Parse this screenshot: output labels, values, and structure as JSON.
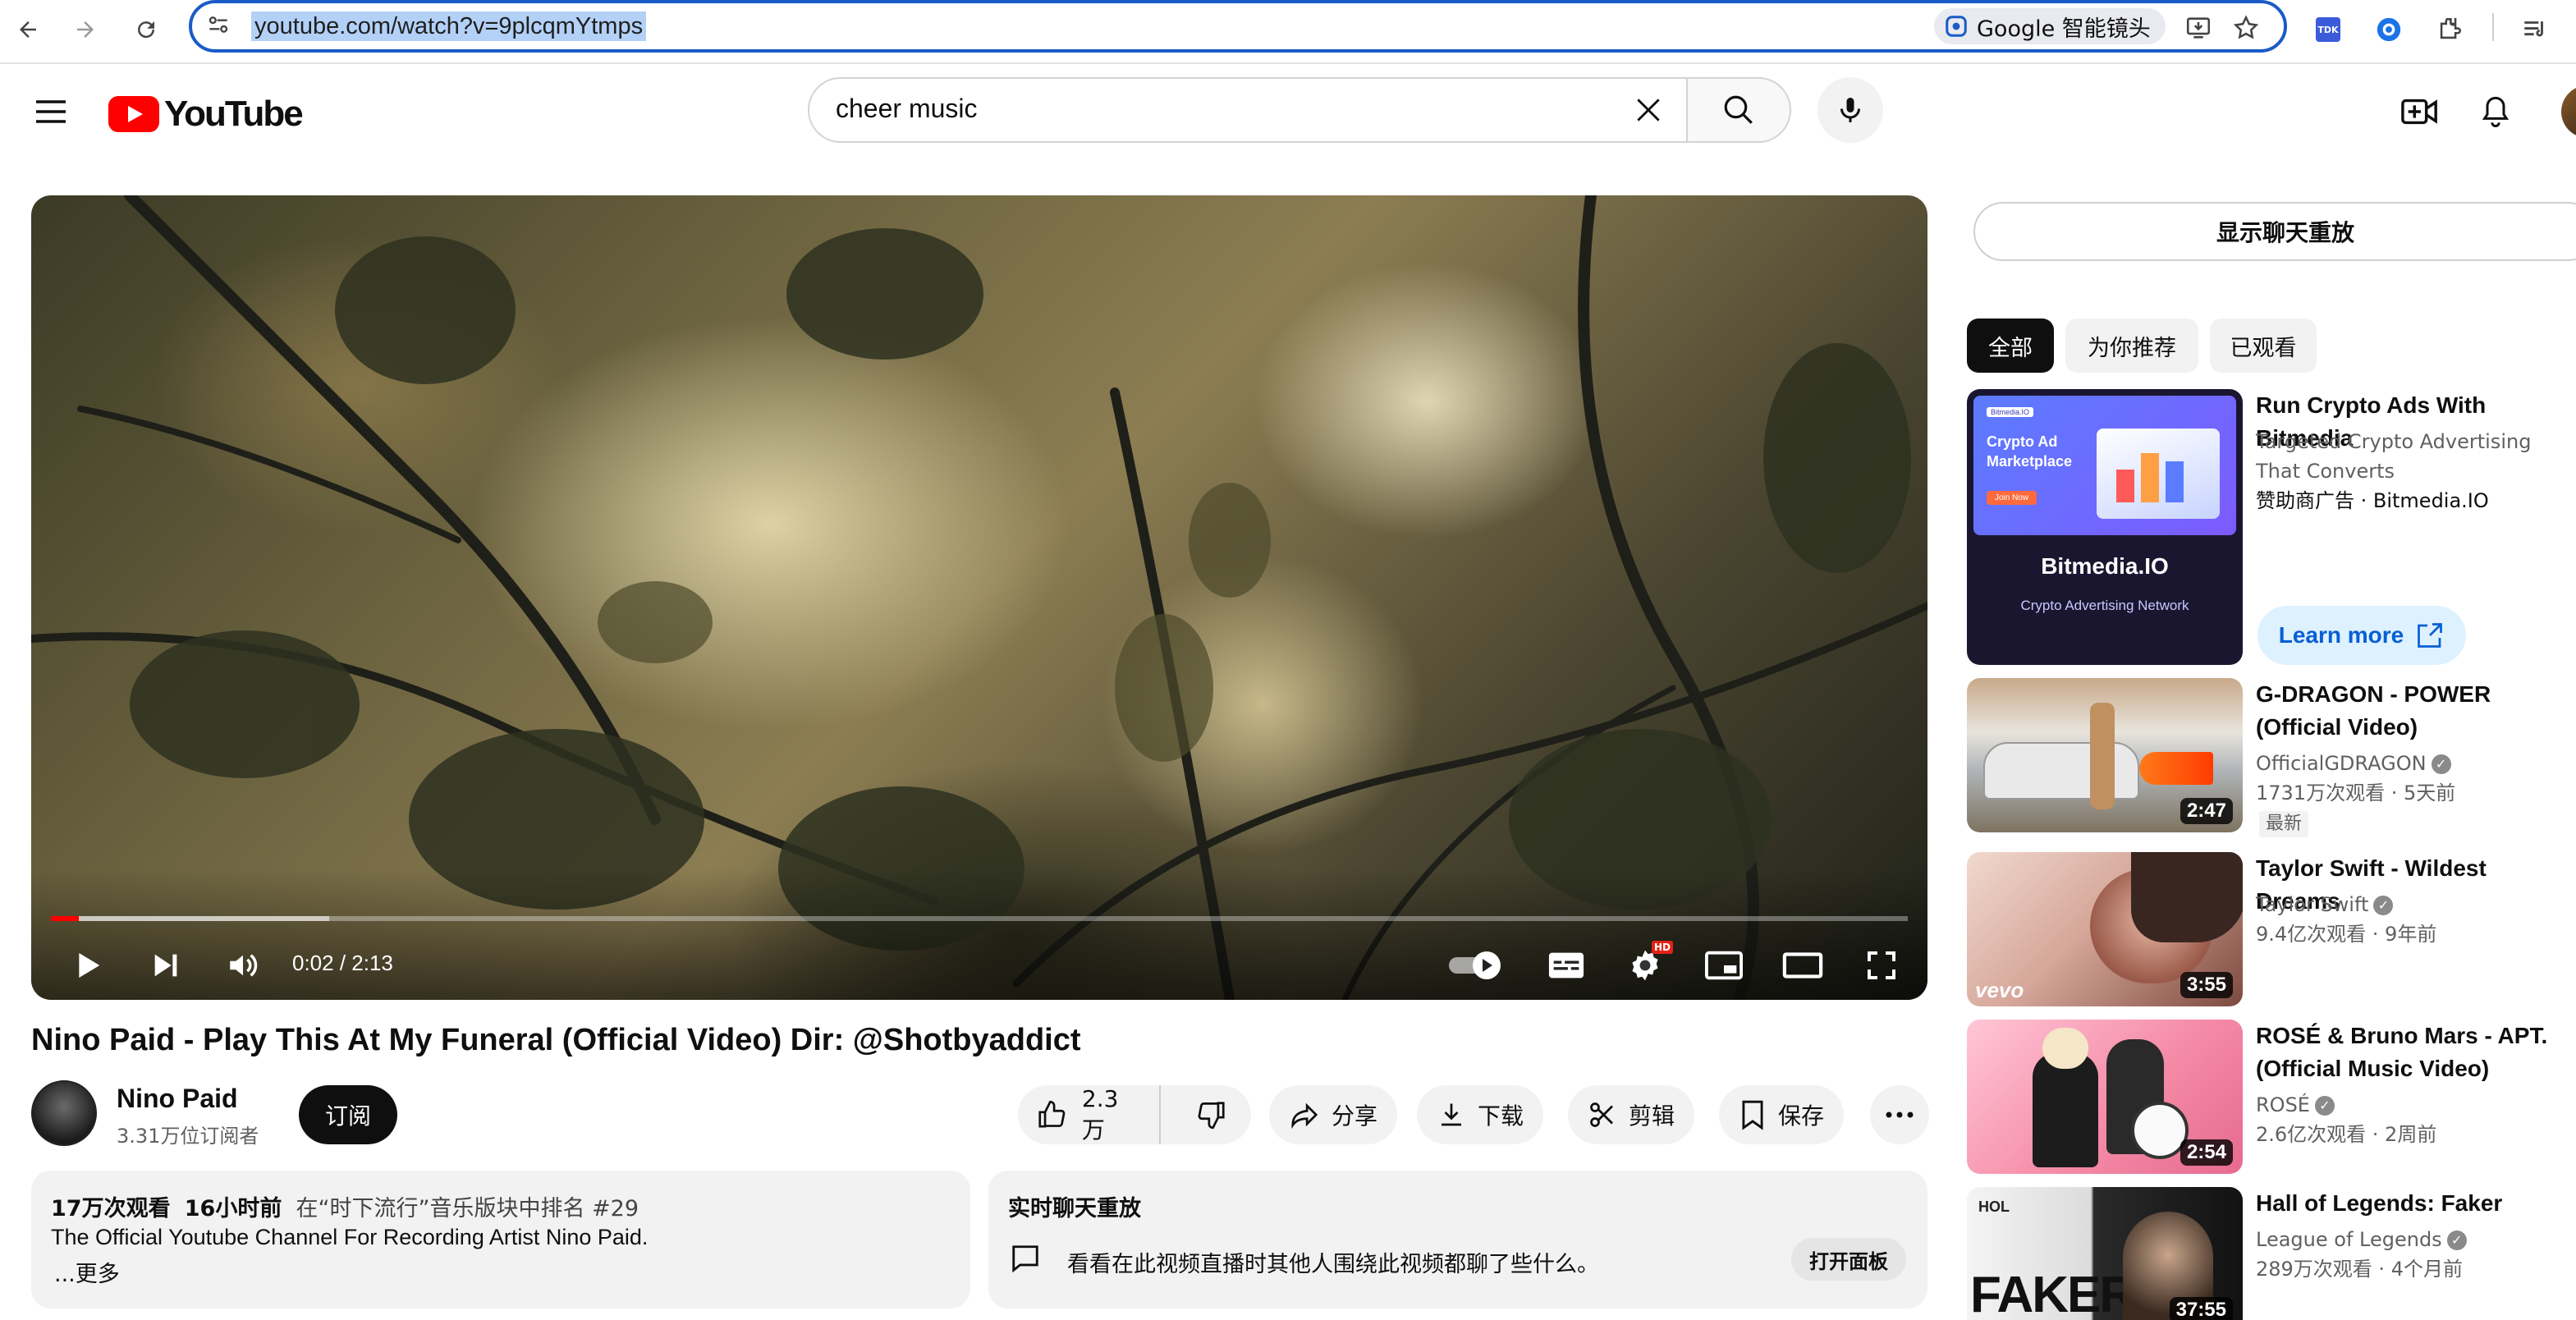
{
  "browser": {
    "url": "youtube.com/watch?v=9plcqmYtmps",
    "lens_label": "Google 智能镜头"
  },
  "header": {
    "logo_text": "YouTube",
    "search_value": "cheer music"
  },
  "player": {
    "time": "0:02 / 2:13",
    "progress_fraction": 0.015,
    "buffer_fraction": 0.15,
    "hd_badge": "HD"
  },
  "video": {
    "title": "Nino Paid - Play This At My Funeral (Official Video) Dir: @Shotbyaddict",
    "channel": "Nino Paid",
    "subscribers": "3.31万位订阅者",
    "subscribe_label": "订阅",
    "likes": "2.3万",
    "share_label": "分享",
    "download_label": "下载",
    "clip_label": "剪辑",
    "save_label": "保存"
  },
  "description": {
    "views": "17万次观看",
    "age": "16小时前",
    "ranking": "在“时下流行”音乐版块中排名 #29",
    "text": "The Official Youtube Channel For Recording Artist Nino Paid.",
    "more": "...更多"
  },
  "live_chat": {
    "title": "实时聊天重放",
    "text": "看看在此视频直播时其他人围绕此视频都聊了些什么。",
    "open_label": "打开面板"
  },
  "sidebar": {
    "chat_replay_label": "显示聊天重放",
    "chips": [
      "全部",
      "为你推荐",
      "已观看"
    ],
    "ad": {
      "title": "Run Crypto Ads With Bitmedia",
      "desc": "Targeted Crypto Advertising That Converts",
      "sponsor": "赞助商广告 · Bitmedia.IO",
      "cta": "Learn more",
      "thumb_small": "Bitmedia.IO",
      "thumb_heading": "Crypto Ad Marketplace",
      "thumb_button": "Join Now",
      "thumb_brand": "Bitmedia.IO",
      "thumb_tagline": "Crypto Advertising Network"
    },
    "videos": [
      {
        "title": "G-DRAGON - POWER (Official Video)",
        "channel": "OfficialGDRAGON",
        "meta": "1731万次观看 · 5天前",
        "badge": "最新",
        "duration": "2:47"
      },
      {
        "title": "Taylor Swift - Wildest Dreams",
        "channel": "Taylor Swift",
        "meta": "9.4亿次观看 · 9年前",
        "duration": "3:55",
        "watermark": "vevo"
      },
      {
        "title": "ROSÉ & Bruno Mars - APT. (Official Music Video)",
        "channel": "ROSÉ",
        "meta": "2.6亿次观看 · 2周前",
        "duration": "2:54"
      },
      {
        "title": "Hall of Legends: Faker",
        "channel": "League of Legends",
        "meta": "289万次观看 · 4个月前",
        "duration": "37:55",
        "thumb_text": "FAKER",
        "thumb_logo": "HOL"
      }
    ]
  }
}
